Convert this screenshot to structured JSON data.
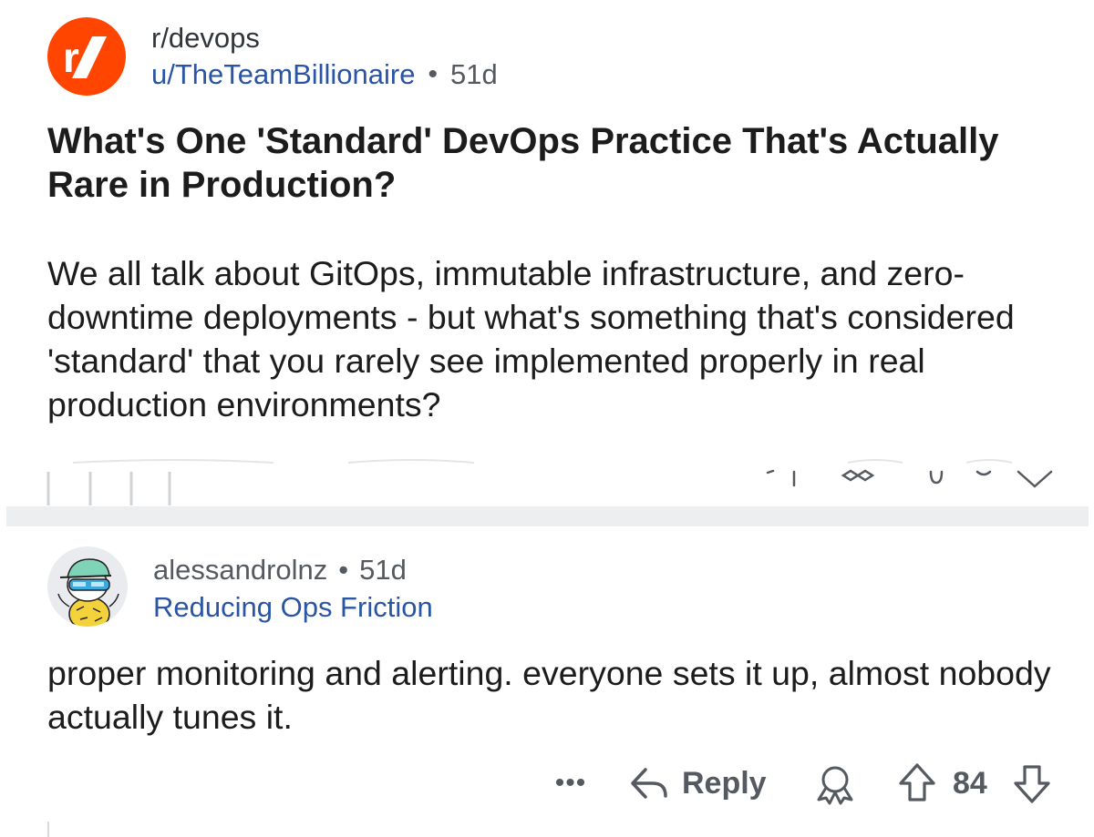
{
  "post": {
    "subreddit": "r/devops",
    "author": "u/TheTeamBillionaire",
    "separator": "•",
    "age": "51d",
    "title": "What's One 'Standard' DevOps Practice That's Actually Rare in Production?",
    "body": "We all talk about GitOps, immutable infrastructure, and zero-downtime deployments - but what's something that's considered 'standard' that you rarely see implemented properly in real production environments?"
  },
  "comment": {
    "author": "alessandrolnz",
    "separator": "•",
    "age": "51d",
    "flair": "Reducing Ops Friction",
    "body": "proper monitoring and alerting. everyone sets it up, almost nobody actually tunes it.",
    "actions": {
      "more": "•••",
      "reply_label": "Reply",
      "score": "84"
    }
  },
  "icons": {
    "subreddit_avatar": "reddit-r-slash-icon",
    "comment_avatar": "snoo-avatar-icon",
    "reply": "reply-arrow-icon",
    "award": "award-icon",
    "upvote": "upvote-arrow-icon",
    "downvote": "downvote-arrow-icon"
  },
  "colors": {
    "brand": "#ff4500",
    "link": "#2a54a4",
    "muted": "#555a60",
    "divider": "#eceef0"
  }
}
